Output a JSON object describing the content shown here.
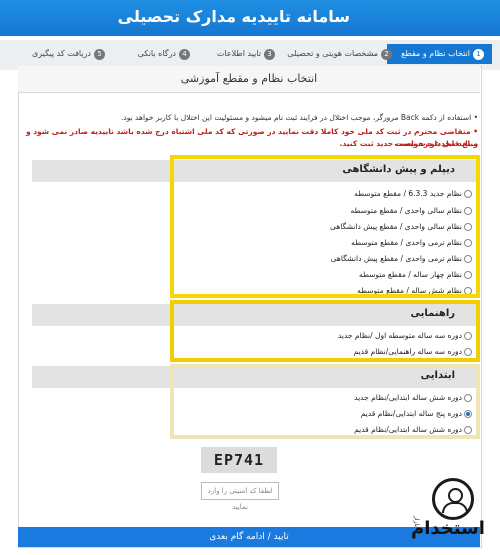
{
  "header": {
    "title": "سامانه تاییدیه مدارک تحصیلی"
  },
  "steps": [
    {
      "num": "1",
      "label": "انتخاب نظام و مقطع"
    },
    {
      "num": "2",
      "label": "مشخصات هویتی و تحصیلی"
    },
    {
      "num": "3",
      "label": "تایید اطلاعات"
    },
    {
      "num": "4",
      "label": "درگاه بانکی"
    },
    {
      "num": "5",
      "label": "دریافت کد پیگیری"
    }
  ],
  "box": {
    "title": "انتخاب نظام و مقطع آموزشی"
  },
  "notes": {
    "back": "• استفاده از دکمه Back مرورگر، موجب اختلال در فرایند ثبت نام میشود و مسئولیت این اختلال با کاربر خواهد بود.",
    "warning_1": "• متقاضی محترم در ثبت کد ملی خود کاملا دقت نمایید در صورتی که کد ملی اشتباه درج شده باشد تاییدیه صادر نمی شود و مبلغ قابل عودت نیست",
    "warning_2": "و باید مجددا درخواست جدید ثبت کنید."
  },
  "sections": {
    "diploma": {
      "title": "دیپلم و پیش دانشگاهی",
      "options": [
        "نظام جدید 6.3.3 / مقطع متوسطه",
        "نظام سالی واحدی / مقطع متوسطه",
        "نظام سالی واحدی / مقطع پیش دانشگاهی",
        "نظام ترمی واحدی / مقطع متوسطه",
        "نظام ترمی واحدی / مقطع پیش دانشگاهی",
        "نظام چهار ساله / مقطع متوسطه",
        "نظام شش ساله / مقطع متوسطه"
      ]
    },
    "guidance": {
      "title": "راهنمایی",
      "options": [
        "دوره سه ساله متوسطه اول /نظام جدید",
        "دوره سه ساله راهنمایی/نظام قدیم"
      ]
    },
    "primary": {
      "title": "ابتدایی",
      "options": [
        "دوره شش ساله ابتدایی/نظام جدید",
        "دوره پنج ساله ابتدایی/نظام قدیم",
        "دوره شش ساله ابتدایی/نظام قدیم"
      ],
      "selected_index": 1
    }
  },
  "captcha": {
    "text": "EP741",
    "placeholder": "لطفا کد امنیتی را وارد نمایید"
  },
  "submit": {
    "label": "تایید / ادامه گام بعدی"
  },
  "watermark": {
    "text": "استخدام",
    "side": "بازار"
  },
  "colors": {
    "header": "#1677d2",
    "highlight_yellow": "#f5d800",
    "highlight_pale": "#f0e6b5",
    "warning_red": "#c0201d"
  }
}
